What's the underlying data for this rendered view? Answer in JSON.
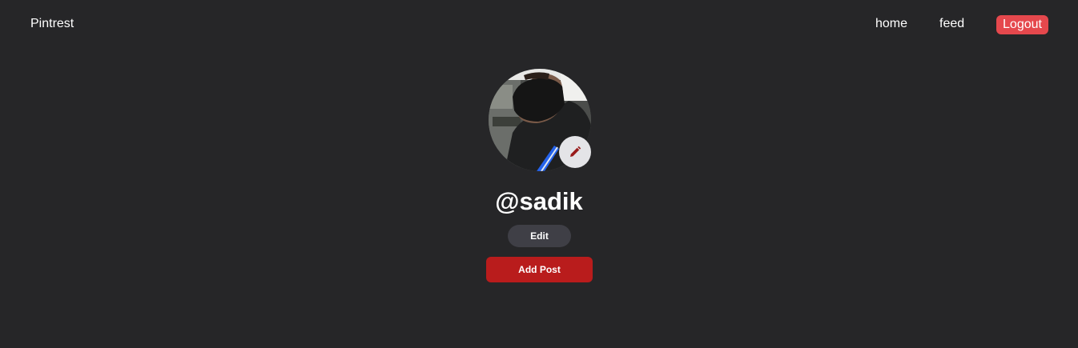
{
  "nav": {
    "brand": "Pintrest",
    "links": [
      {
        "label": "home"
      },
      {
        "label": "feed"
      }
    ],
    "logout_label": "Logout"
  },
  "profile": {
    "username": "@sadik",
    "avatar_icon": "profile-photo",
    "edit_picture_icon": "pencil-icon",
    "edit_label": "Edit",
    "add_post_label": "Add Post"
  },
  "colors": {
    "background": "#262628",
    "logout": "#e5484d",
    "add_post": "#b91c1c",
    "edit_button": "#3f3f46",
    "pencil": "#991b1b"
  }
}
